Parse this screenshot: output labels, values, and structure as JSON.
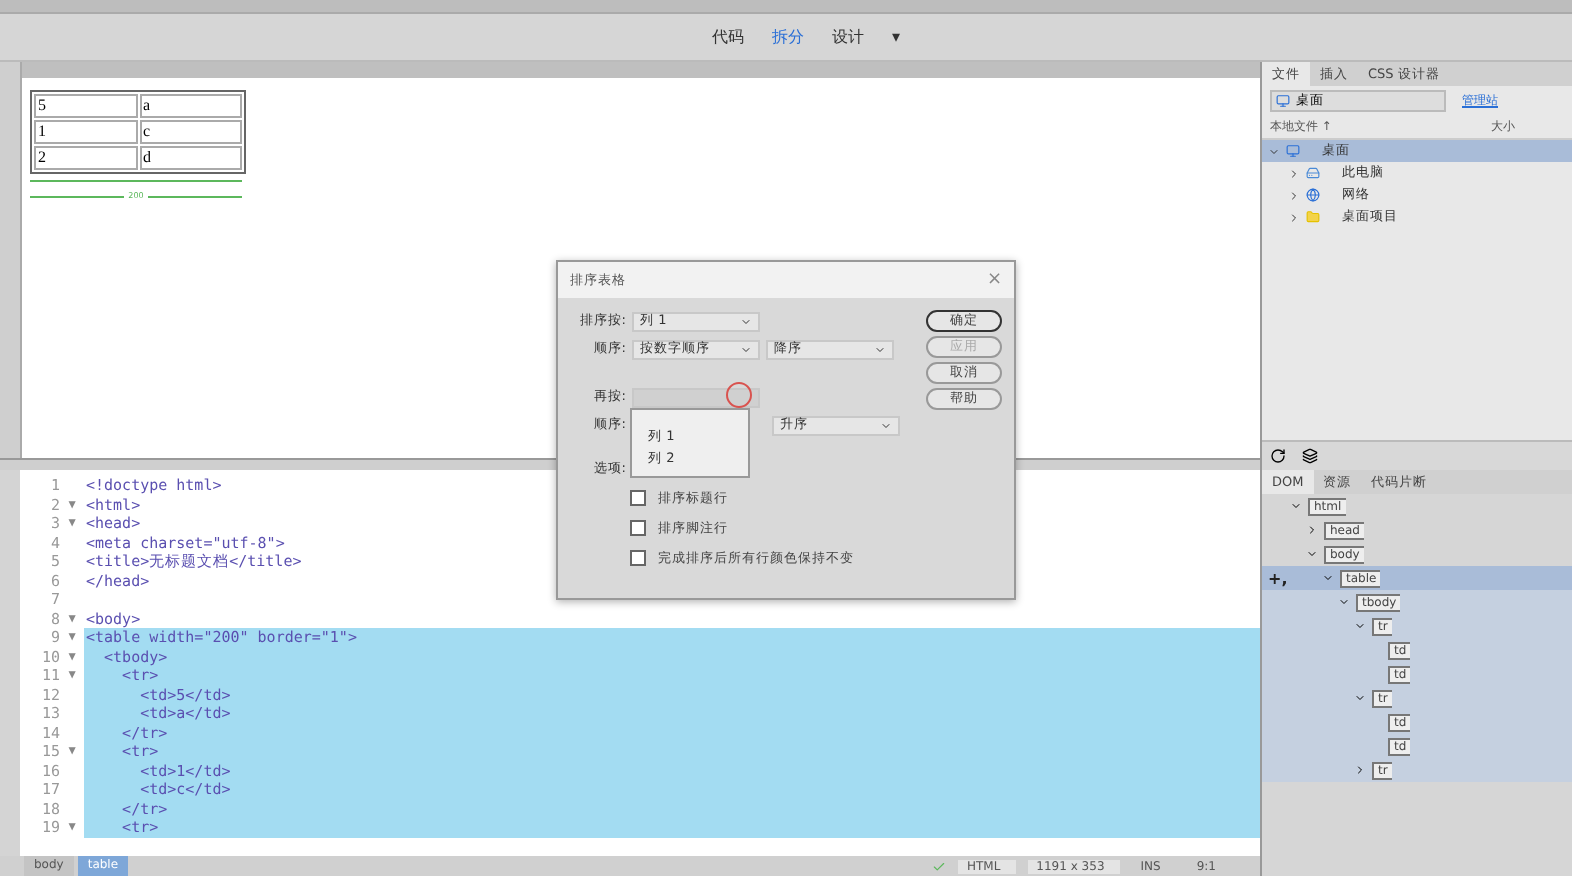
{
  "view_switch": [
    {
      "label": "代码",
      "selected": false
    },
    {
      "label": "拆分",
      "selected": true
    },
    {
      "label": "设计",
      "selected": false
    }
  ],
  "view_menu": "▾",
  "design_table": [
    [
      "5",
      "a"
    ],
    [
      "1",
      "c"
    ],
    [
      "2",
      "d"
    ]
  ],
  "design_width_label": "200",
  "code_lines": [
    {
      "number": "1",
      "text": "<!doctype html>",
      "highlighted": false
    },
    {
      "number": "2",
      "fold_marker": "▼",
      "text": "<html>",
      "highlighted": false
    },
    {
      "number": "3",
      "fold_marker": "▼",
      "text": "<head>",
      "highlighted": false
    },
    {
      "number": "4",
      "text": "<meta charset=\"utf-8\">",
      "highlighted": false
    },
    {
      "number": "5",
      "text": "<title>无标题文档</title>",
      "highlighted": false
    },
    {
      "number": "6",
      "text": "</head>",
      "highlighted": false
    },
    {
      "number": "7",
      "highlighted": false
    },
    {
      "number": "8",
      "fold_marker": "▼",
      "text": "<body>",
      "highlighted": false
    },
    {
      "number": "9",
      "fold_marker": "▼",
      "text": "<table width=\"200\" border=\"1\">",
      "highlighted": true
    },
    {
      "number": "10",
      "fold_marker": "▼",
      "text": "  <tbody>",
      "highlighted": true
    },
    {
      "number": "11",
      "fold_marker": "▼",
      "text": "    <tr>",
      "highlighted": true
    },
    {
      "number": "12",
      "text": "      <td>5</td>",
      "highlighted": true
    },
    {
      "number": "13",
      "text": "      <td>a</td>",
      "highlighted": true
    },
    {
      "number": "14",
      "text": "    </tr>",
      "highlighted": true
    },
    {
      "number": "15",
      "fold_marker": "▼",
      "text": "    <tr>",
      "highlighted": true
    },
    {
      "number": "16",
      "text": "      <td>1</td>",
      "highlighted": true
    },
    {
      "number": "17",
      "text": "      <td>c</td>",
      "highlighted": true
    },
    {
      "number": "18",
      "text": "    </tr>",
      "highlighted": true
    },
    {
      "number": "19",
      "fold_marker": "▼",
      "text": "    <tr>",
      "highlighted": true
    }
  ],
  "tag_path": [
    {
      "label": "body",
      "selected": false
    },
    {
      "label": "table",
      "selected": true
    }
  ],
  "status": {
    "language": "HTML",
    "size": "1191 x 353",
    "mode": "INS",
    "position": "9:1"
  },
  "dialog": {
    "title": "排序表格",
    "close": "×",
    "sort_by": {
      "label": "排序按:",
      "value": "列 1"
    },
    "order1": {
      "label": "顺序:",
      "method": "按数字顺序",
      "direction": "降序"
    },
    "then_by": {
      "label": "再按:"
    },
    "order2": {
      "label": "顺序:",
      "direction": "升序"
    },
    "dropdown_options": [
      {
        "label": "列 1",
        "selected": false
      },
      {
        "label": "列 2",
        "selected": false
      }
    ],
    "options_label": "选项:",
    "checkboxes": [
      {
        "label": "排序标题行",
        "checked": false
      },
      {
        "label": "排序脚注行",
        "checked": false
      },
      {
        "label": "完成排序后所有行颜色保持不变",
        "checked": false
      }
    ],
    "buttons": [
      {
        "label": "确定",
        "disabled": false,
        "default": true
      },
      {
        "label": "应用",
        "disabled": true,
        "default": false
      },
      {
        "label": "取消",
        "disabled": false,
        "default": false
      },
      {
        "label": "帮助",
        "disabled": false,
        "default": false
      }
    ]
  },
  "files_panel": {
    "tabs": [
      {
        "label": "文件",
        "selected": true
      },
      {
        "label": "插入",
        "selected": false
      },
      {
        "label": "CSS 设计器",
        "selected": false
      }
    ],
    "site": "桌面",
    "manage_link": "管理站",
    "columns": [
      "本地文件 ↑",
      "大小"
    ],
    "tree": [
      {
        "label": "桌面",
        "kind": "desktop",
        "selected": true,
        "expanded": true,
        "children": [
          {
            "label": "此电脑",
            "kind": "computer",
            "selected": false,
            "expanded": false
          },
          {
            "label": "网络",
            "kind": "network",
            "selected": false,
            "expanded": false
          },
          {
            "label": "桌面项目",
            "kind": "folder",
            "selected": false,
            "expanded": false
          }
        ]
      }
    ]
  },
  "dom_panel": {
    "tabs": [
      {
        "label": "DOM",
        "selected": true
      },
      {
        "label": "资源",
        "selected": false
      },
      {
        "label": "代码片断",
        "selected": false
      }
    ],
    "add_marker": "+,",
    "tree": [
      {
        "tag": "html",
        "expanded": true,
        "selected": false,
        "children": [
          {
            "tag": "head",
            "expanded": false,
            "selected": false
          },
          {
            "tag": "body",
            "expanded": true,
            "selected": false,
            "children": [
              {
                "tag": "table",
                "expanded": true,
                "selected": true,
                "children": [
                  {
                    "tag": "tbody",
                    "expanded": true,
                    "selected": false,
                    "children": [
                      {
                        "tag": "tr",
                        "expanded": true,
                        "selected": false,
                        "children": [
                          {
                            "tag": "td",
                            "selected": false
                          },
                          {
                            "tag": "td",
                            "selected": false
                          }
                        ]
                      },
                      {
                        "tag": "tr",
                        "expanded": true,
                        "selected": false,
                        "children": [
                          {
                            "tag": "td",
                            "selected": false
                          },
                          {
                            "tag": "td",
                            "selected": false
                          }
                        ]
                      },
                      {
                        "tag": "tr",
                        "expanded": false,
                        "selected": false
                      }
                    ]
                  }
                ]
              }
            ]
          }
        ]
      }
    ]
  }
}
